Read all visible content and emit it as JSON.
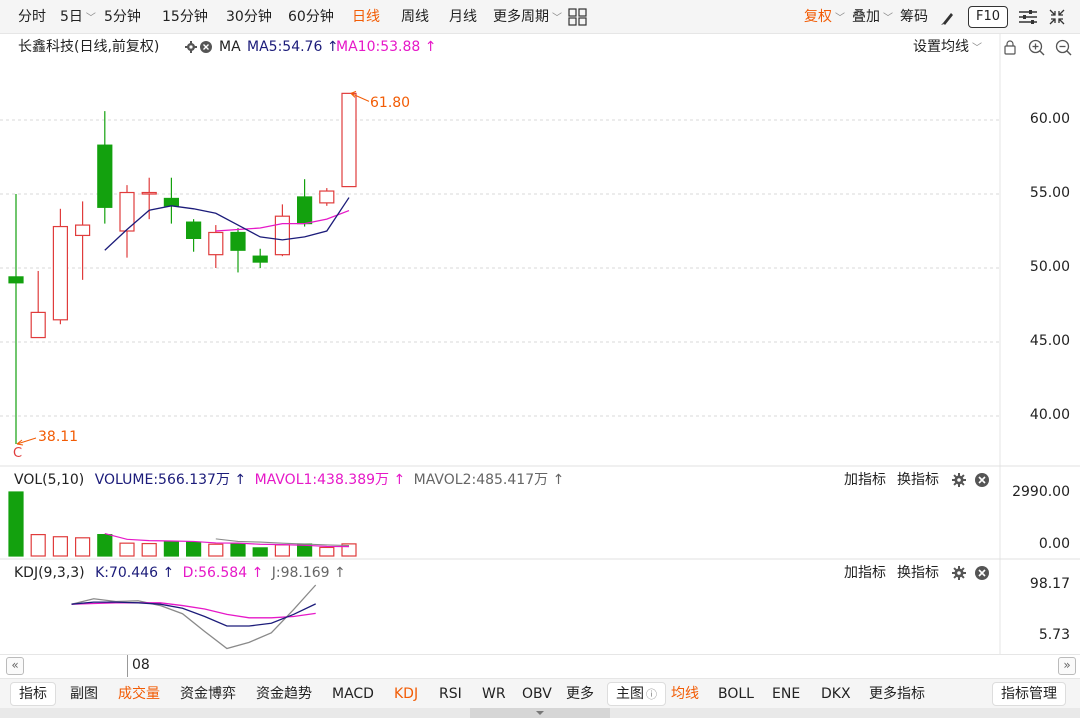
{
  "topbar": {
    "periods": [
      "分时",
      "5日",
      "5分钟",
      "15分钟",
      "30分钟",
      "60分钟",
      "日线",
      "周线",
      "月线",
      "更多周期"
    ],
    "active_period": "日线",
    "fuquan": "复权",
    "diejia": "叠加",
    "chouma": "筹码",
    "f10": "F10"
  },
  "info": {
    "stock": "长鑫科技(日线,前复权)",
    "ma_label": "MA",
    "ma5": "MA5:54.76",
    "ma10": "MA10:53.88",
    "settings": "设置均线"
  },
  "main_chart": {
    "y_ticks": [
      "60.00",
      "55.00",
      "50.00",
      "45.00",
      "40.00"
    ],
    "high_label": "61.80",
    "low_label": "38.11",
    "c_marker": "C"
  },
  "vol": {
    "title": "VOL(5,10)",
    "volume": "VOLUME:566.137万",
    "mavol1": "MAVOL1:438.389万",
    "mavol2": "MAVOL2:485.417万",
    "add_indicator": "加指标",
    "switch_indicator": "换指标",
    "y_top": "2990.00",
    "y_bottom": "0.00"
  },
  "kdj": {
    "title": "KDJ(9,3,3)",
    "k": "K:70.446",
    "d": "D:56.584",
    "j": "J:98.169",
    "add_indicator": "加指标",
    "switch_indicator": "换指标",
    "y_top": "98.17",
    "y_bottom": "5.73"
  },
  "xaxis": {
    "label": "08"
  },
  "bottombar": {
    "left_items": [
      "指标",
      "副图",
      "成交量",
      "资金博弈",
      "资金趋势",
      "MACD",
      "KDJ",
      "RSI",
      "WR",
      "OBV",
      "更多"
    ],
    "main_label": "主图",
    "main_items": [
      "均线",
      "BOLL",
      "ENE",
      "DKX",
      "更多指标"
    ],
    "manage": "指标管理"
  },
  "colors": {
    "up": "#e03c3c",
    "down": "#13a10e",
    "ma5": "#1c1c7a",
    "ma10": "#e619c8",
    "accent": "#f25c05",
    "j_line": "#8a8a8a"
  },
  "chart_data": {
    "type": "candlestick",
    "candles": [
      {
        "open": 49.4,
        "close": 49.0,
        "high": 55.0,
        "low": 38.11,
        "dir": "down"
      },
      {
        "open": 45.3,
        "close": 47.0,
        "high": 49.8,
        "low": 45.3,
        "dir": "up"
      },
      {
        "open": 46.5,
        "close": 52.8,
        "high": 54.0,
        "low": 46.2,
        "dir": "up"
      },
      {
        "open": 52.2,
        "close": 52.9,
        "high": 54.5,
        "low": 49.2,
        "dir": "up"
      },
      {
        "open": 58.3,
        "close": 54.1,
        "high": 60.6,
        "low": 53.0,
        "dir": "down"
      },
      {
        "open": 52.5,
        "close": 55.1,
        "high": 55.6,
        "low": 50.7,
        "dir": "up"
      },
      {
        "open": 55.1,
        "close": 55.1,
        "high": 56.1,
        "low": 53.3,
        "dir": "up"
      },
      {
        "open": 54.7,
        "close": 54.2,
        "high": 56.1,
        "low": 53.0,
        "dir": "down"
      },
      {
        "open": 53.1,
        "close": 52.0,
        "high": 53.3,
        "low": 51.1,
        "dir": "down"
      },
      {
        "open": 50.9,
        "close": 52.4,
        "high": 52.9,
        "low": 50.0,
        "dir": "up"
      },
      {
        "open": 52.4,
        "close": 51.2,
        "high": 52.7,
        "low": 49.7,
        "dir": "down"
      },
      {
        "open": 50.8,
        "close": 50.4,
        "high": 51.3,
        "low": 50.0,
        "dir": "down"
      },
      {
        "open": 50.9,
        "close": 53.5,
        "high": 54.3,
        "low": 50.8,
        "dir": "up"
      },
      {
        "open": 54.8,
        "close": 53.0,
        "high": 56.0,
        "low": 52.8,
        "dir": "down"
      },
      {
        "open": 54.4,
        "close": 55.2,
        "high": 55.4,
        "low": 54.2,
        "dir": "up"
      },
      {
        "open": 55.5,
        "close": 61.8,
        "high": 61.8,
        "low": 55.5,
        "dir": "up"
      }
    ],
    "ma5": [
      null,
      null,
      null,
      null,
      51.2,
      52.6,
      53.9,
      54.2,
      54.0,
      53.7,
      52.9,
      52.1,
      51.9,
      52.1,
      52.5,
      54.76
    ],
    "ma10": [
      null,
      null,
      null,
      null,
      null,
      null,
      null,
      null,
      null,
      52.5,
      52.6,
      52.7,
      53.0,
      53.0,
      53.3,
      53.88
    ],
    "volume": [
      2990,
      1000,
      900,
      850,
      1000,
      600,
      580,
      650,
      650,
      550,
      560,
      380,
      520,
      560,
      400,
      566.137
    ],
    "mavol1": [
      null,
      null,
      null,
      null,
      1050,
      780,
      720,
      700,
      680,
      610,
      600,
      550,
      530,
      500,
      450,
      438.389
    ],
    "mavol2": [
      null,
      null,
      null,
      null,
      null,
      null,
      null,
      null,
      null,
      800,
      680,
      650,
      600,
      560,
      520,
      485.417
    ],
    "kdj_k": [
      null,
      null,
      70,
      73,
      73,
      72,
      70,
      64,
      52,
      38,
      38,
      42,
      55,
      70.446
    ],
    "kdj_d": [
      null,
      null,
      70,
      71,
      72,
      72,
      72,
      68,
      63,
      55,
      50,
      50,
      52,
      56.584
    ],
    "kdj_j": [
      null,
      null,
      70,
      78,
      74,
      75,
      68,
      56,
      30,
      5,
      14,
      28,
      62,
      98.169
    ],
    "y_range": [
      36.3,
      64.0
    ],
    "vol_range": [
      0,
      2990
    ],
    "kdj_range": [
      5.73,
      98.17
    ],
    "x_label": "08"
  }
}
